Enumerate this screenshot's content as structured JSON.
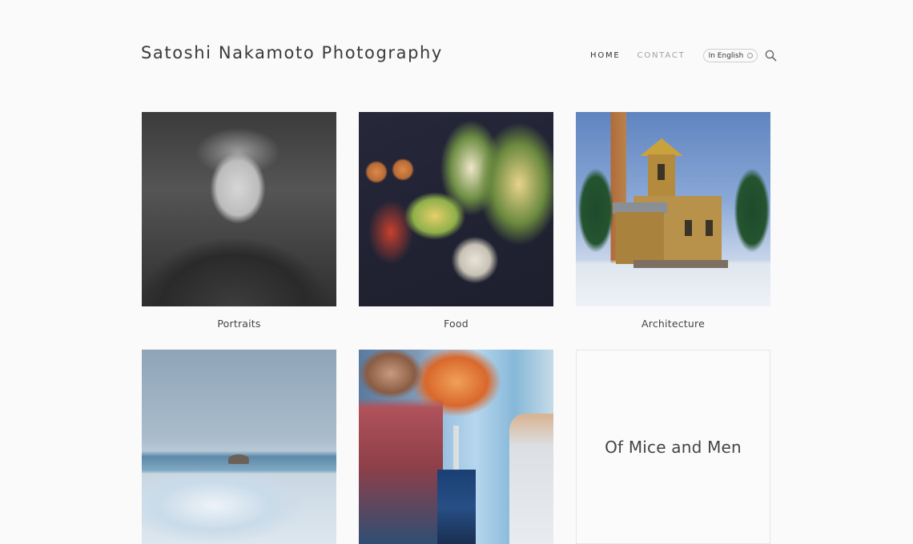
{
  "header": {
    "site_title": "Satoshi Nakamoto Photography",
    "nav": [
      {
        "label": "HOME",
        "active": true
      },
      {
        "label": "CONTACT",
        "active": false
      }
    ],
    "language_label": "In English",
    "search_icon": "search-icon"
  },
  "gallery": [
    {
      "caption": "Portraits"
    },
    {
      "caption": "Food"
    },
    {
      "caption": "Architecture"
    },
    {
      "caption": ""
    },
    {
      "caption": ""
    },
    {
      "card_title": "Of Mice and Men"
    }
  ],
  "colors": {
    "background": "#fafafb",
    "text": "#333333",
    "muted_nav": "#a0a0a0"
  }
}
